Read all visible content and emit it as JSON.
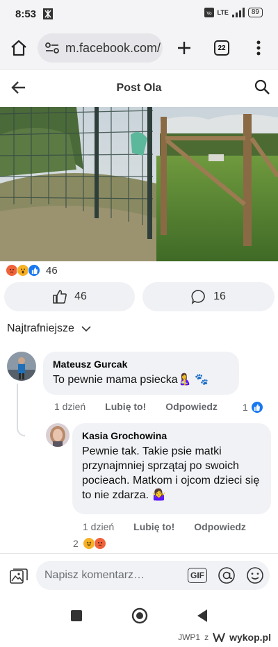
{
  "status": {
    "time": "8:53",
    "network": "LTE",
    "battery": "89"
  },
  "browser": {
    "url": "m.facebook.com/",
    "tab_count": "22"
  },
  "header": {
    "title": "Post Ola"
  },
  "post": {
    "reactions_count": "46",
    "like_count": "46",
    "comment_count": "16"
  },
  "sort_label": "Najtrafniejsze",
  "comments": [
    {
      "author": "Mateusz Gurcak",
      "text": "To pewnie mama psiecka🤱 🐾",
      "time": "1 dzień",
      "like_label": "Lubię to!",
      "reply_label": "Odpowiedz",
      "reaction_count": "1"
    },
    {
      "author": "Kasia Grochowina",
      "text": "Pewnie tak. Takie psie matki przynajmniej sprzątaj po swoich pocieach. Matkom i ojcom dzieci się to nie zdarza. 🤷‍♀️",
      "time": "1 dzień",
      "like_label": "Lubię to!",
      "reply_label": "Odpowiedz",
      "reaction_count": "2"
    }
  ],
  "composer": {
    "placeholder": "Napisz komentarz…",
    "gif_label": "GIF"
  },
  "watermark": {
    "user": "JWP1",
    "sep": "z",
    "site": "wykop.pl"
  },
  "colors": {
    "like_blue": "#1877f2",
    "angry": "#f0623a",
    "wow": "#f7b125",
    "bubble_bg": "#f0f2f5"
  }
}
